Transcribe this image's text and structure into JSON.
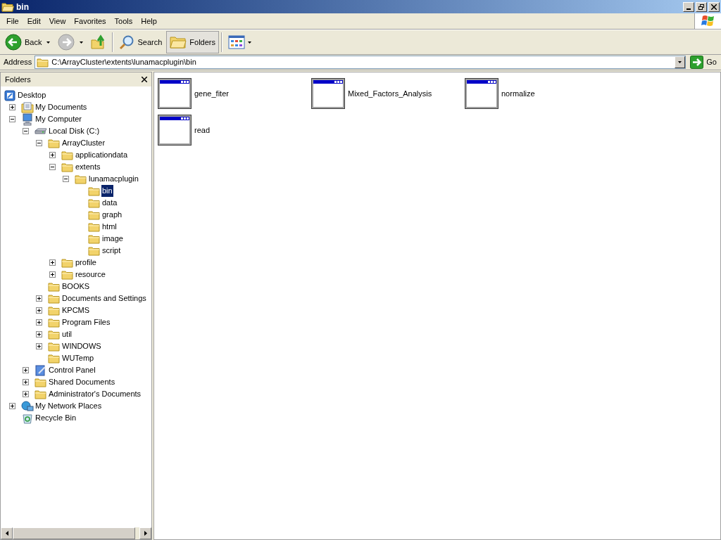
{
  "window": {
    "title": "bin"
  },
  "menu": [
    "File",
    "Edit",
    "View",
    "Favorites",
    "Tools",
    "Help"
  ],
  "toolbar": [
    {
      "kind": "back",
      "label": "Back",
      "disabled": false,
      "pressed": false
    },
    {
      "kind": "forward",
      "disabled": true,
      "pressed": false
    },
    {
      "kind": "up",
      "disabled": false,
      "pressed": false
    },
    {
      "kind": "separator"
    },
    {
      "kind": "search",
      "label": "Search",
      "disabled": false,
      "pressed": false
    },
    {
      "kind": "folders",
      "label": "Folders",
      "disabled": false,
      "pressed": true
    },
    {
      "kind": "separator"
    },
    {
      "kind": "views",
      "disabled": false,
      "pressed": false
    }
  ],
  "address": {
    "label": "Address",
    "value": "C:\\ArrayCluster\\extents\\lunamacplugin\\bin",
    "go": "Go"
  },
  "folders_pane": {
    "title": "Folders",
    "tree": [
      {
        "label": "Desktop",
        "kind": "desktop",
        "selected": false,
        "children": [
          {
            "label": "My Documents",
            "kind": "documents",
            "expandable": true,
            "expanded": false,
            "selected": false
          },
          {
            "label": "My Computer",
            "kind": "computer",
            "expandable": true,
            "expanded": true,
            "selected": false,
            "children": [
              {
                "label": "Local Disk (C:)",
                "kind": "drive",
                "expandable": true,
                "expanded": true,
                "selected": false,
                "children": [
                  {
                    "label": "ArrayCluster",
                    "kind": "folder",
                    "expandable": true,
                    "expanded": true,
                    "selected": false,
                    "children": [
                      {
                        "label": "applicationdata",
                        "kind": "folder",
                        "expandable": true,
                        "expanded": false,
                        "selected": false
                      },
                      {
                        "label": "extents",
                        "kind": "folder",
                        "expandable": true,
                        "expanded": true,
                        "selected": false,
                        "children": [
                          {
                            "label": "lunamacplugin",
                            "kind": "folder",
                            "expandable": true,
                            "expanded": true,
                            "selected": false,
                            "children": [
                              {
                                "label": "bin",
                                "kind": "folder",
                                "expandable": false,
                                "selected": true
                              },
                              {
                                "label": "data",
                                "kind": "folder",
                                "expandable": false,
                                "selected": false
                              },
                              {
                                "label": "graph",
                                "kind": "folder",
                                "expandable": false,
                                "selected": false
                              },
                              {
                                "label": "html",
                                "kind": "folder",
                                "expandable": false,
                                "selected": false
                              },
                              {
                                "label": "image",
                                "kind": "folder",
                                "expandable": false,
                                "selected": false
                              },
                              {
                                "label": "script",
                                "kind": "folder",
                                "expandable": false,
                                "selected": false
                              }
                            ]
                          }
                        ]
                      },
                      {
                        "label": "profile",
                        "kind": "folder",
                        "expandable": true,
                        "expanded": false,
                        "selected": false
                      },
                      {
                        "label": "resource",
                        "kind": "folder",
                        "expandable": true,
                        "expanded": false,
                        "selected": false
                      }
                    ]
                  },
                  {
                    "label": "BOOKS",
                    "kind": "folder",
                    "expandable": false,
                    "selected": false
                  },
                  {
                    "label": "Documents and Settings",
                    "kind": "folder",
                    "expandable": true,
                    "expanded": false,
                    "selected": false
                  },
                  {
                    "label": "KPCMS",
                    "kind": "folder",
                    "expandable": true,
                    "expanded": false,
                    "selected": false
                  },
                  {
                    "label": "Program Files",
                    "kind": "folder",
                    "expandable": true,
                    "expanded": false,
                    "selected": false
                  },
                  {
                    "label": "util",
                    "kind": "folder",
                    "expandable": true,
                    "expanded": false,
                    "selected": false
                  },
                  {
                    "label": "WINDOWS",
                    "kind": "folder",
                    "expandable": true,
                    "expanded": false,
                    "selected": false
                  },
                  {
                    "label": "WUTemp",
                    "kind": "folder",
                    "expandable": false,
                    "selected": false
                  }
                ]
              },
              {
                "label": "Control Panel",
                "kind": "control-panel",
                "expandable": true,
                "expanded": false,
                "selected": false
              },
              {
                "label": "Shared Documents",
                "kind": "folder",
                "expandable": true,
                "expanded": false,
                "selected": false
              },
              {
                "label": "Administrator's Documents",
                "kind": "folder",
                "expandable": true,
                "expanded": false,
                "selected": false
              }
            ]
          },
          {
            "label": "My Network Places",
            "kind": "network",
            "expandable": true,
            "expanded": false,
            "selected": false
          },
          {
            "label": "Recycle Bin",
            "kind": "recycle",
            "expandable": false,
            "selected": false
          }
        ]
      }
    ]
  },
  "files": [
    {
      "name": "gene_fiter"
    },
    {
      "name": "Mixed_Factors_Analysis"
    },
    {
      "name": "normalize"
    },
    {
      "name": "read"
    }
  ]
}
